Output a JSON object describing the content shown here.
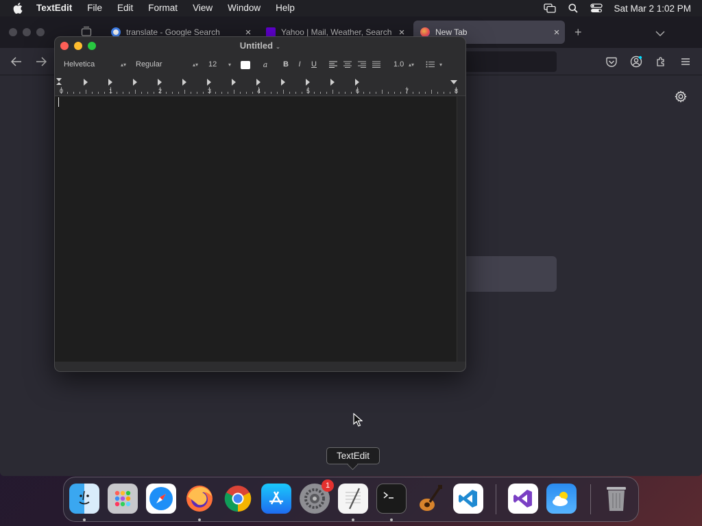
{
  "menubar": {
    "app_name": "TextEdit",
    "items": [
      "File",
      "Edit",
      "Format",
      "View",
      "Window",
      "Help"
    ],
    "clock": "Sat Mar 2  1:02 PM",
    "status_icons": [
      "screen-mirroring-icon",
      "spotlight-search-icon",
      "control-center-icon"
    ]
  },
  "browser": {
    "tabs": [
      {
        "title": "translate - Google Search",
        "favicon": "google-icon"
      },
      {
        "title": "Yahoo | Mail, Weather, Search",
        "favicon": "yahoo-icon"
      },
      {
        "title": "New Tab",
        "favicon": "firefox-icon",
        "active": true
      }
    ],
    "toolbar_icons": [
      "back-icon",
      "forward-icon",
      "pocket-icon",
      "account-icon",
      "extensions-icon",
      "menu-icon"
    ]
  },
  "textedit": {
    "title": "Untitled",
    "toolbar": {
      "font_family": "Helvetica",
      "font_style": "Regular",
      "font_size": "12",
      "bold": "B",
      "italic": "I",
      "underline": "U",
      "line_spacing": "1.0"
    },
    "ruler_numbers": [
      "0",
      "1",
      "2",
      "3",
      "4",
      "5",
      "6",
      "7",
      "8"
    ],
    "document_text": ""
  },
  "tooltip": "TextEdit",
  "dock": {
    "apps": [
      {
        "name": "Finder",
        "running": true
      },
      {
        "name": "Launchpad",
        "running": false
      },
      {
        "name": "Safari",
        "running": false
      },
      {
        "name": "Firefox",
        "running": true
      },
      {
        "name": "Google Chrome",
        "running": false
      },
      {
        "name": "App Store",
        "running": false
      },
      {
        "name": "System Settings",
        "running": false,
        "badge": "1"
      },
      {
        "name": "TextEdit",
        "running": true
      },
      {
        "name": "Terminal",
        "running": true
      },
      {
        "name": "GarageBand",
        "running": false
      },
      {
        "name": "Visual Studio Code",
        "running": false
      },
      {
        "name": "Visual Studio",
        "running": false
      },
      {
        "name": "Weather",
        "running": false
      },
      {
        "name": "Trash",
        "running": false
      }
    ]
  },
  "colors": {
    "close": "#fe5f57",
    "minimize": "#febc2e",
    "zoom": "#28c840",
    "badge": "#e5312f"
  }
}
